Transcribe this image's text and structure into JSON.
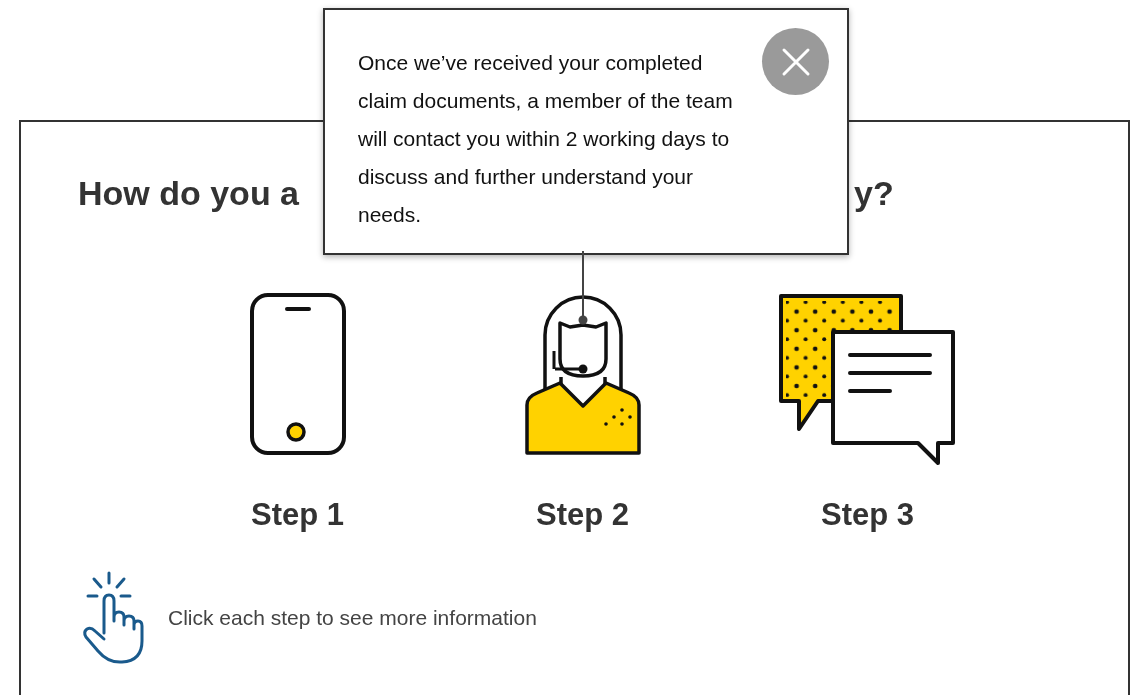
{
  "heading": {
    "start": "How do you a",
    "end": "y?"
  },
  "tooltip": {
    "text": "Once we’ve received your completed claim documents, a member of the team will contact you within 2 working days to discuss and further understand your needs."
  },
  "steps": [
    {
      "label": "Step 1",
      "kind": "phone",
      "selected": false
    },
    {
      "label": "Step 2",
      "kind": "agent",
      "selected": true
    },
    {
      "label": "Step 3",
      "kind": "chat",
      "selected": false
    }
  ],
  "hint": "Click each step to see more information"
}
